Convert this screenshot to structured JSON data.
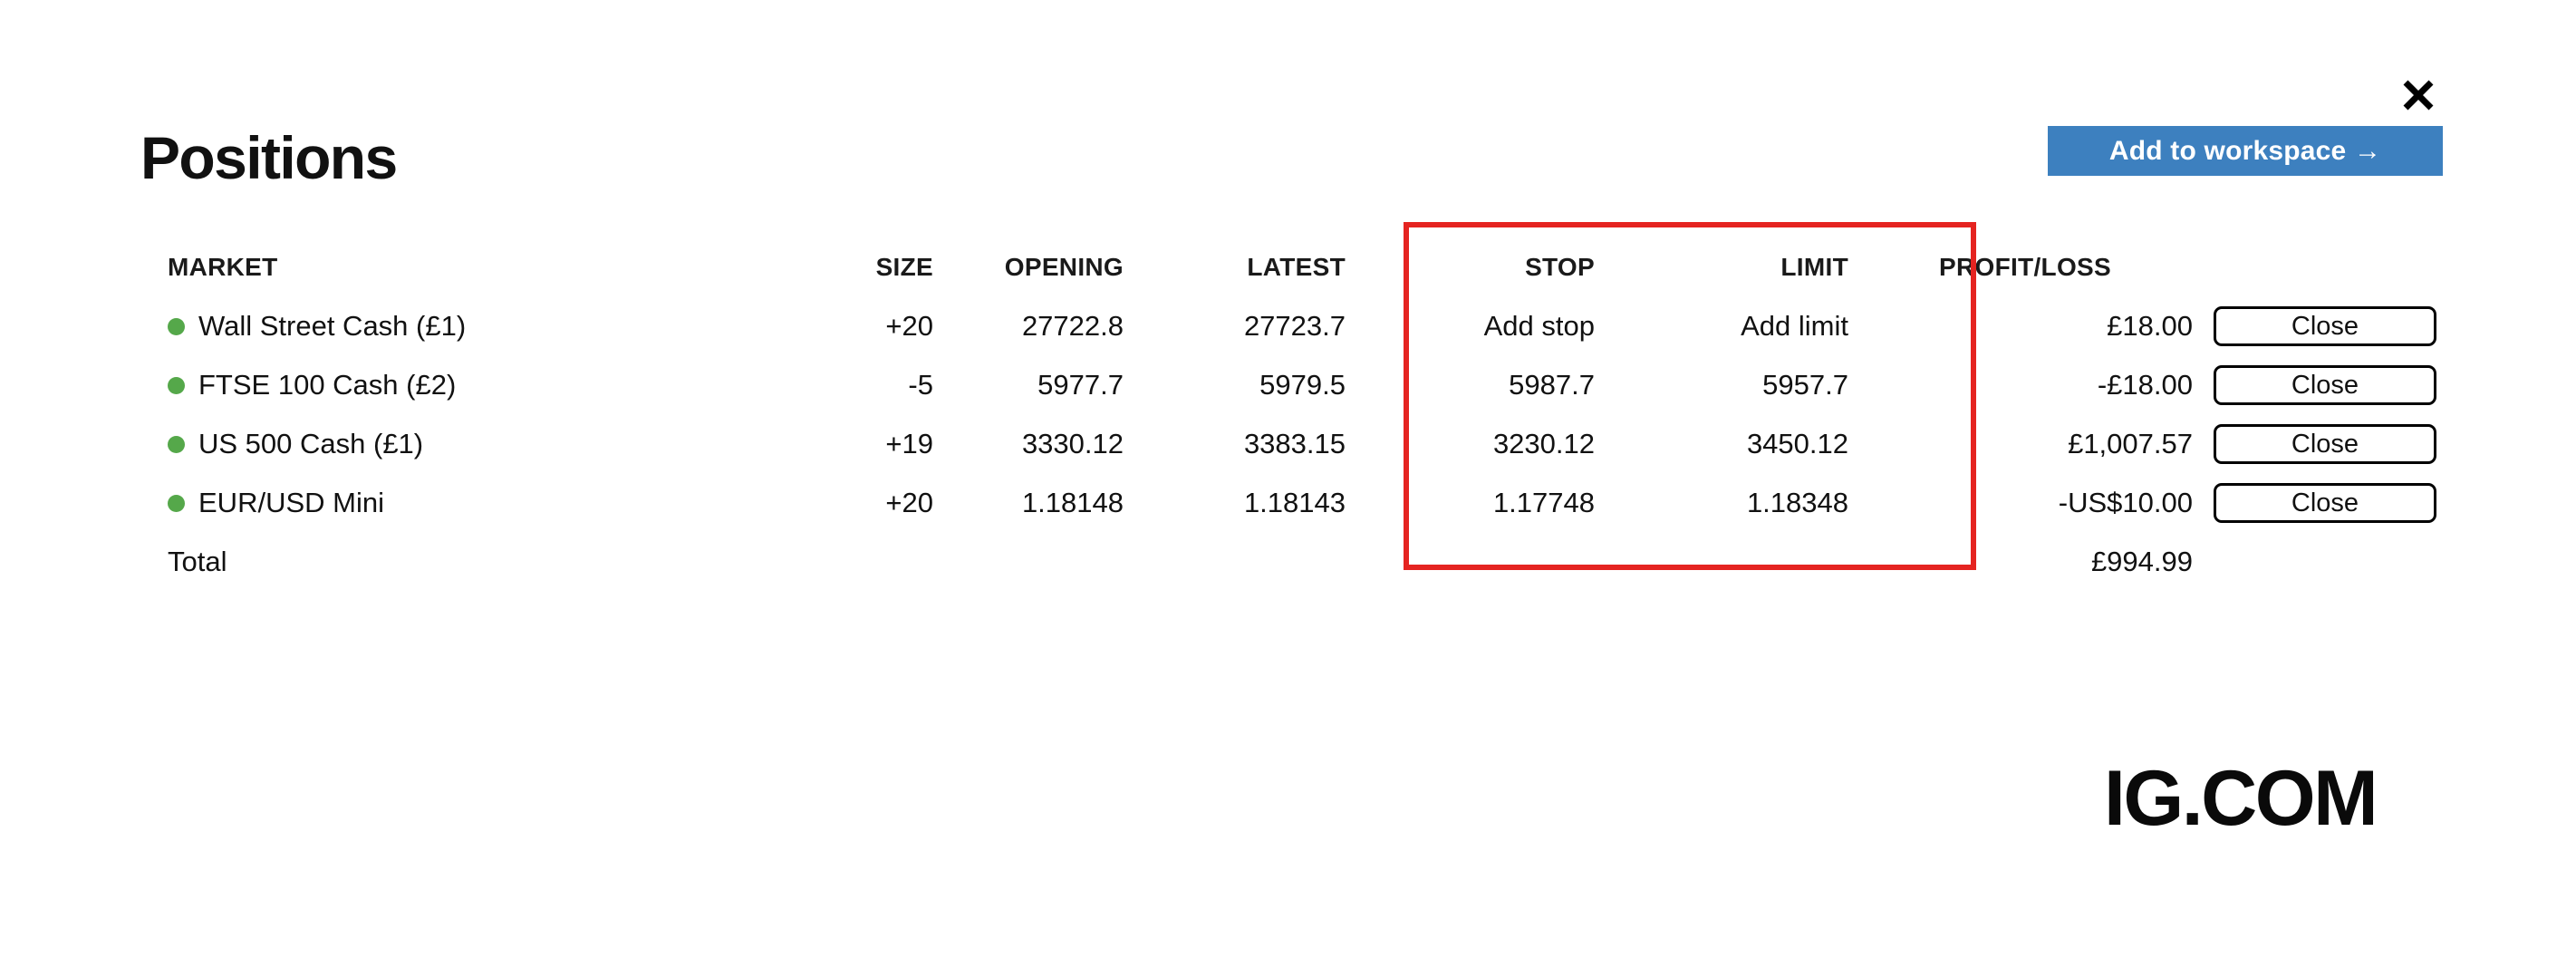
{
  "window": {
    "title": "Positions",
    "close_icon": "close-x-icon"
  },
  "toolbar": {
    "add_to_workspace_label": "Add to workspace →"
  },
  "table": {
    "columns": [
      "MARKET",
      "SIZE",
      "OPENING",
      "LATEST",
      "STOP",
      "LIMIT",
      "PROFIT/LOSS"
    ],
    "rows": [
      {
        "market": "Wall Street Cash (£1)",
        "status_dot": "green",
        "size": "+20",
        "size_sign": "pos",
        "opening": "27722.8",
        "latest": "27723.7",
        "stop": "Add stop",
        "limit": "Add limit",
        "profit_loss": "£18.00",
        "pl_sign": "pos",
        "action_label": "Close"
      },
      {
        "market": "FTSE 100 Cash (£2)",
        "status_dot": "green",
        "size": "-5",
        "size_sign": "neg",
        "opening": "5977.7",
        "latest": "5979.5",
        "stop": "5987.7",
        "limit": "5957.7",
        "profit_loss": "-£18.00",
        "pl_sign": "neg",
        "action_label": "Close"
      },
      {
        "market": "US 500 Cash (£1)",
        "status_dot": "green",
        "size": "+19",
        "size_sign": "pos",
        "opening": "3330.12",
        "latest": "3383.15",
        "stop": "3230.12",
        "limit": "3450.12",
        "profit_loss": "£1,007.57",
        "pl_sign": "pos",
        "action_label": "Close"
      },
      {
        "market": "EUR/USD Mini",
        "status_dot": "green",
        "size": "+20",
        "size_sign": "pos",
        "opening": "1.18148",
        "latest": "1.18143",
        "stop": "1.17748",
        "limit": "1.18348",
        "profit_loss": "-US$10.00",
        "pl_sign": "neg",
        "action_label": "Close"
      }
    ],
    "total": {
      "label": "Total",
      "profit_loss": "£994.99",
      "pl_sign": "pos"
    }
  },
  "annotation": {
    "highlight_color": "#e52421",
    "highlight_target": "STOP and LIMIT columns"
  },
  "branding": {
    "logo_text": "IG.COM"
  },
  "colors": {
    "positive": "#3d80bf",
    "negative": "#d62828",
    "status_green": "#55a84a",
    "accent_button": "#3d80bf",
    "highlight_red": "#e52421"
  }
}
